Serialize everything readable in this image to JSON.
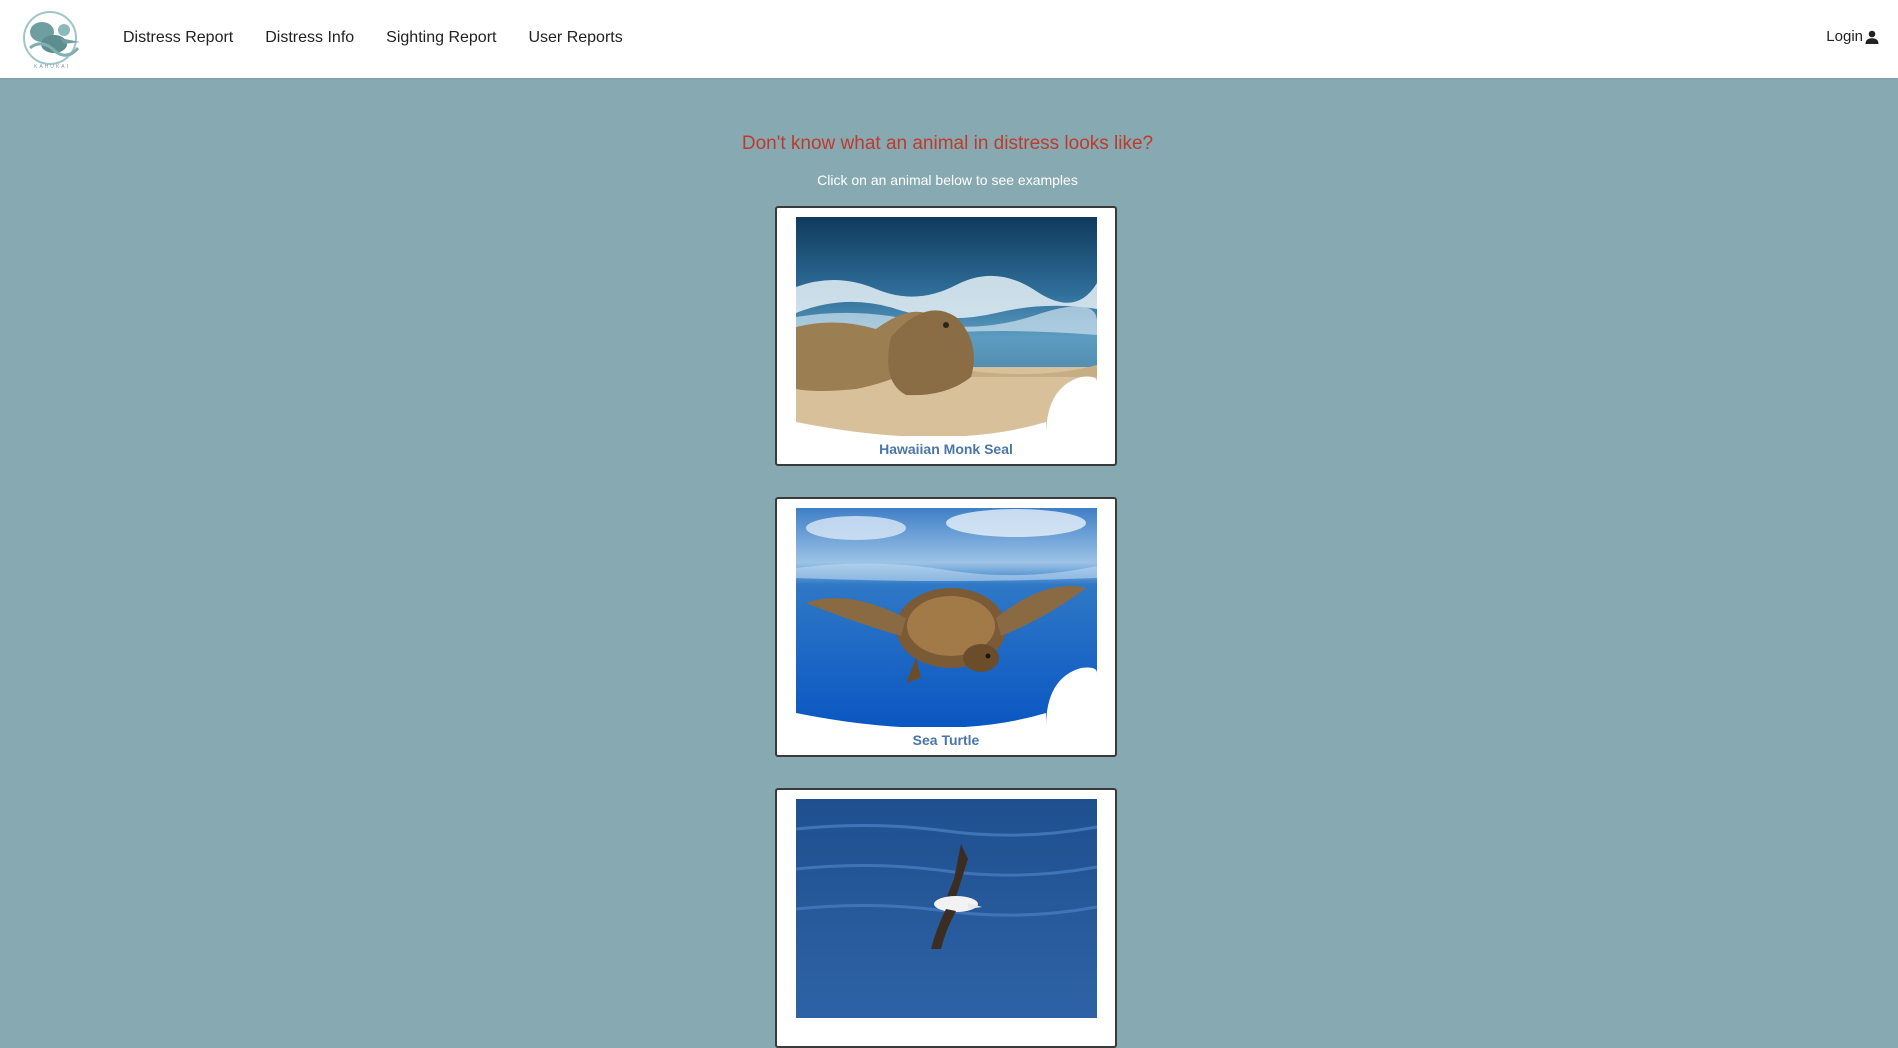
{
  "brand": {
    "logo_text": "KAHUKAI"
  },
  "nav": {
    "items": [
      {
        "label": "Distress Report"
      },
      {
        "label": "Distress Info"
      },
      {
        "label": "Sighting Report"
      },
      {
        "label": "User Reports"
      }
    ],
    "login_label": "Login",
    "login_icon": "user-icon"
  },
  "main": {
    "heading": "Don't know what an animal in distress looks like?",
    "subheading": "Click on an animal below to see examples",
    "cards": [
      {
        "label": "Hawaiian Monk Seal"
      },
      {
        "label": "Sea Turtle"
      },
      {
        "label": ""
      }
    ]
  },
  "colors": {
    "page_background": "#87aab2",
    "heading": "#c0392b",
    "card_label": "#4a76a8",
    "navbar": "#ffffff"
  }
}
